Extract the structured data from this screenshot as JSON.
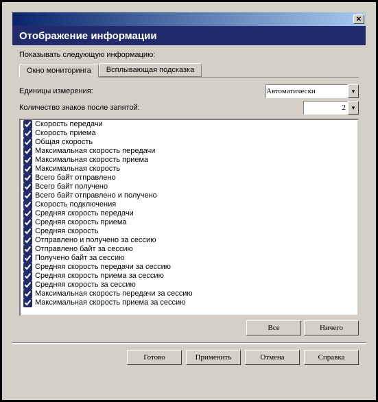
{
  "titlebar": {
    "close": "✕"
  },
  "header": {
    "title": "Отображение информации"
  },
  "prompt": "Показывать следующую информацию:",
  "tabs": {
    "active": "Окно мониторинга",
    "inactive": "Всплывающая подсказка"
  },
  "units_label": "Единицы измерения:",
  "units_value": "Автоматически",
  "decimals_label": "Количество знаков после запятой:",
  "decimals_value": "2",
  "items": [
    "Скорость передачи",
    "Скорость приема",
    "Общая скорость",
    "Максимальная скорость передачи",
    "Максимальная скорость приема",
    "Максимальная скорость",
    "Всего байт отправлено",
    "Всего байт получено",
    "Всего байт отправлено и получено",
    "Скорость подключения",
    "Средняя скорость передачи",
    "Средняя скорость приема",
    "Средняя скорость",
    "Отправлено и получено за сессию",
    "Отправлено байт за сессию",
    "Получено байт за сессию",
    "Средняя скорость передачи за сессию",
    "Средняя скорость приема за сессию",
    "Средняя скорость за сессию",
    "Максимальная скорость передачи за сессию",
    "Максимальная скорость приема за сессию"
  ],
  "buttons": {
    "all": "Все",
    "none": "Ничего",
    "done": "Готово",
    "apply": "Применить",
    "cancel": "Отмена",
    "help": "Справка"
  }
}
